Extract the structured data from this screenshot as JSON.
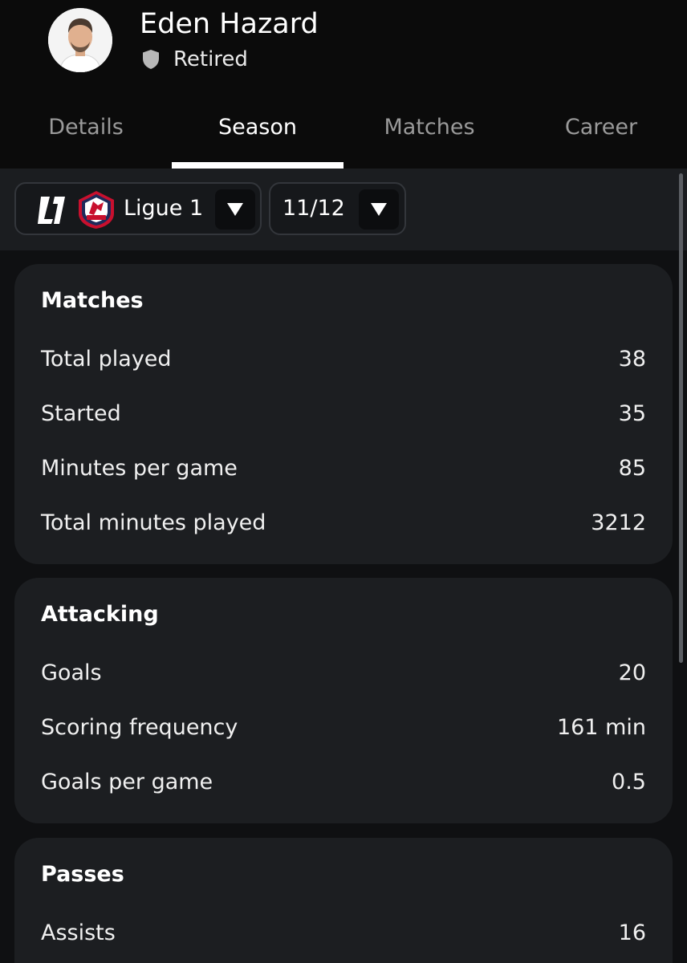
{
  "player": {
    "name": "Eden Hazard",
    "status": "Retired"
  },
  "tabs": [
    {
      "label": "Details"
    },
    {
      "label": "Season"
    },
    {
      "label": "Matches"
    },
    {
      "label": "Career"
    }
  ],
  "active_tab": "Season",
  "filters": {
    "league": "Ligue 1",
    "season": "11/12"
  },
  "sections": [
    {
      "title": "Matches",
      "rows": [
        {
          "label": "Total played",
          "value": "38"
        },
        {
          "label": "Started",
          "value": "35"
        },
        {
          "label": "Minutes per game",
          "value": "85"
        },
        {
          "label": "Total minutes played",
          "value": "3212"
        }
      ]
    },
    {
      "title": "Attacking",
      "rows": [
        {
          "label": "Goals",
          "value": "20"
        },
        {
          "label": "Scoring frequency",
          "value": "161 min"
        },
        {
          "label": "Goals per game",
          "value": "0.5"
        }
      ]
    },
    {
      "title": "Passes",
      "rows": [
        {
          "label": "Assists",
          "value": "16"
        }
      ]
    }
  ],
  "icons": {
    "status": "shield-icon",
    "league_logo": "ligue1-logo-icon",
    "club_logo": "losc-crest-icon",
    "dropdown": "caret-down-icon"
  },
  "colors": {
    "background": "#0f1012",
    "header": "#0b0b0b",
    "card": "#1c1e21",
    "filter_bar": "#1b1d20",
    "active_tab": "#ffffff",
    "inactive_tab": "#9a9a9a",
    "club_red": "#c8102e",
    "club_navy": "#1f2a5a"
  }
}
